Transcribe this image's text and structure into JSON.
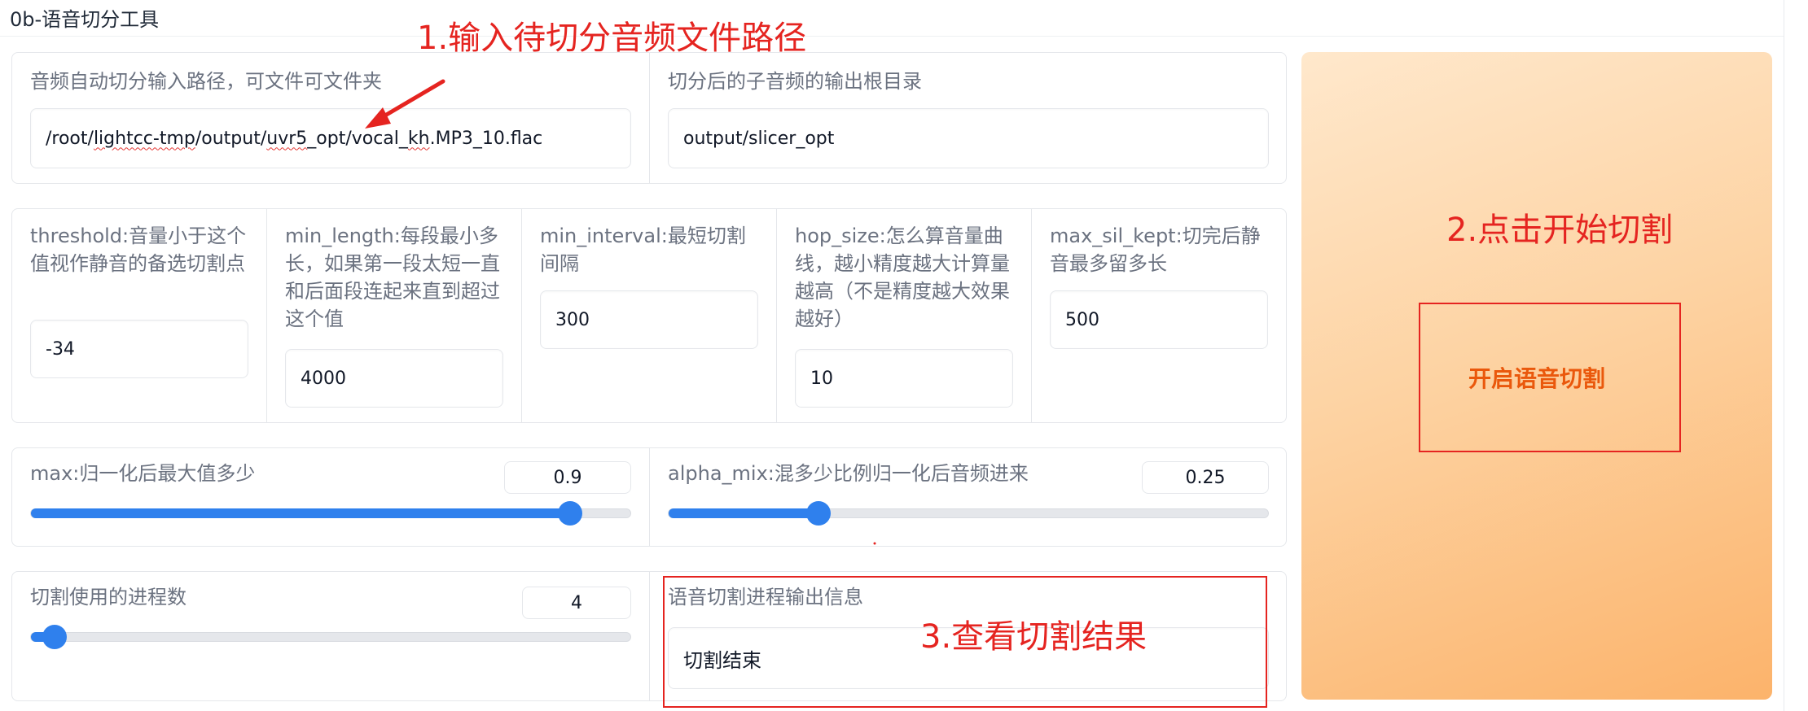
{
  "app": {
    "title": "0b-语音切分工具"
  },
  "paths": {
    "input_label": "音频自动切分输入路径，可文件可文件夹",
    "input_value_parts": [
      "/root/",
      "lightcc-tmp",
      "/output/",
      "uvr5",
      "_opt/vocal_",
      "kh",
      ".MP3_10.flac"
    ],
    "output_label": "切分后的子音频的输出根目录",
    "output_value": "output/slicer_opt"
  },
  "params": [
    {
      "label": "threshold:音量小于这个值视作静音的备选切割点",
      "value": "-34"
    },
    {
      "label": "min_length:每段最小多长，如果第一段太短一直和后面段连起来直到超过这个值",
      "value": "4000"
    },
    {
      "label": "min_interval:最短切割间隔",
      "value": "300"
    },
    {
      "label": "hop_size:怎么算音量曲线，越小精度越大计算量越高（不是精度越大效果越好）",
      "value": "10"
    },
    {
      "label": "max_sil_kept:切完后静音最多留多长",
      "value": "500"
    }
  ],
  "sliders": {
    "max": {
      "label": "max:归一化后最大值多少",
      "value": "0.9",
      "fraction": 0.9
    },
    "alpha_mix": {
      "label": "alpha_mix:混多少比例归一化后音频进来",
      "value": "0.25",
      "fraction": 0.25
    },
    "processes": {
      "label": "切割使用的进程数",
      "value": "4",
      "fraction": 0.04
    }
  },
  "output_info": {
    "label": "语音切割进程输出信息",
    "value": "切割结束"
  },
  "run_button": {
    "label": "开启语音切割"
  },
  "annotations": {
    "step1": "1.输入待切分音频文件路径",
    "step2": "2.点击开始切割",
    "step3": "3.查看切割结果"
  },
  "colors": {
    "accent": "#2f80ed",
    "annotation": "#e52420",
    "button_text": "#ea580c"
  }
}
